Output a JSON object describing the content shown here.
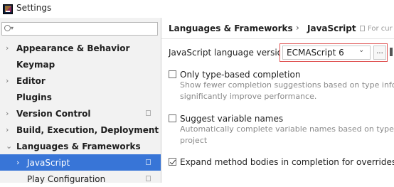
{
  "window": {
    "title": "Settings"
  },
  "search": {
    "placeholder": "",
    "value": ""
  },
  "sidebar": {
    "items": [
      {
        "label": "Appearance & Behavior",
        "expandable": true
      },
      {
        "label": "Keymap",
        "expandable": false
      },
      {
        "label": "Editor",
        "expandable": true
      },
      {
        "label": "Plugins",
        "expandable": false
      },
      {
        "label": "Version Control",
        "expandable": true
      },
      {
        "label": "Build, Execution, Deployment",
        "expandable": true
      },
      {
        "label": "Languages & Frameworks",
        "expandable": true,
        "expanded": true
      },
      {
        "label": "JavaScript",
        "expandable": true,
        "selected": true
      },
      {
        "label": "Play Configuration",
        "expandable": false
      }
    ]
  },
  "breadcrumb": {
    "parent": "Languages & Frameworks",
    "separator": "›",
    "current": "JavaScript",
    "scope_hint": "For cur"
  },
  "language_version": {
    "label": "JavaScript language version",
    "value": "ECMAScript 6",
    "more_button": "..."
  },
  "options": [
    {
      "label": "Only type-based completion",
      "checked": false,
      "description": [
        "Show fewer completion suggestions based on type infor",
        "significantly improve performance."
      ]
    },
    {
      "label": "Suggest variable names",
      "checked": false,
      "description": [
        "Automatically complete variable names based on types c",
        "project"
      ]
    },
    {
      "label": "Expand method bodies in completion for overrides",
      "checked": true,
      "description": []
    }
  ],
  "colors": {
    "selection": "#3875d7",
    "highlight_border": "#e05555"
  }
}
